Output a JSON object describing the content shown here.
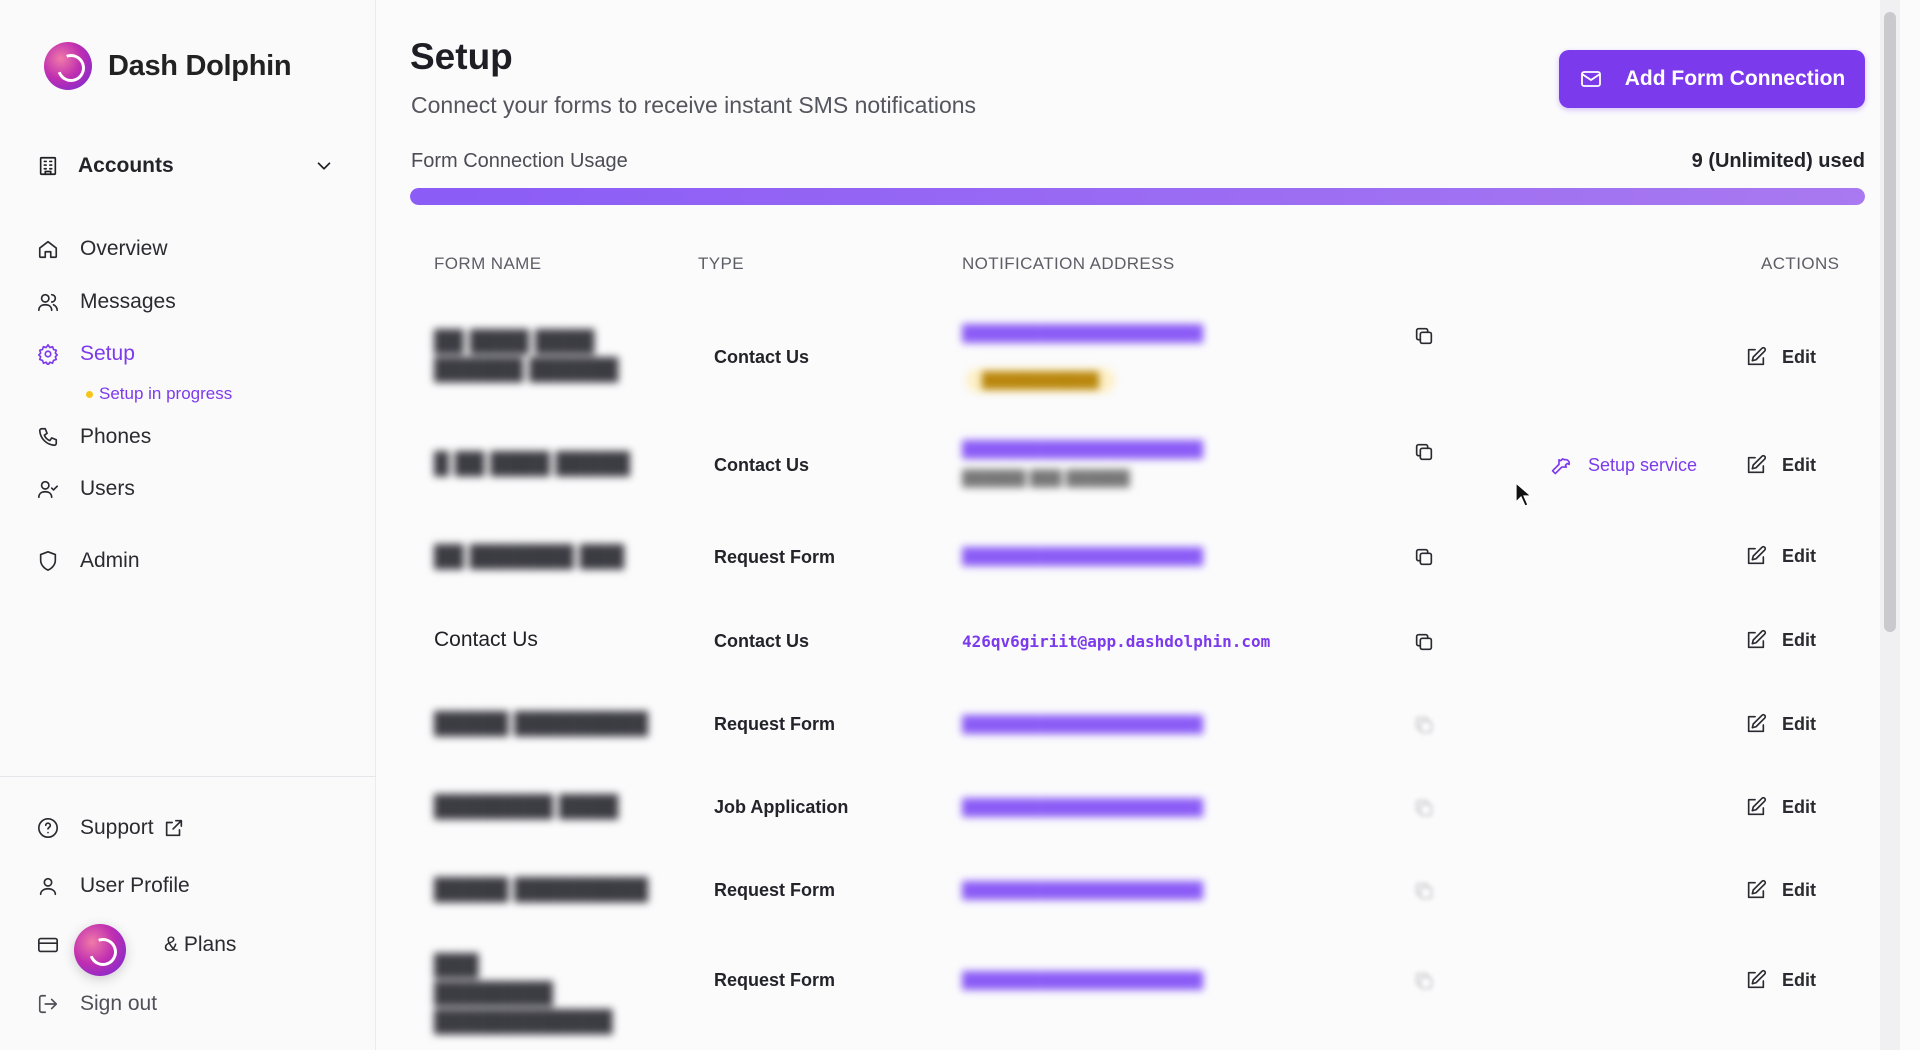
{
  "brand": {
    "name": "Dash Dolphin"
  },
  "sidebar": {
    "accounts_label": "Accounts",
    "items": [
      {
        "label": "Overview",
        "icon": "home-icon"
      },
      {
        "label": "Messages",
        "icon": "users-icon"
      },
      {
        "label": "Setup",
        "icon": "gear-icon"
      },
      {
        "label": "Phones",
        "icon": "phone-icon"
      },
      {
        "label": "Users",
        "icon": "user-check-icon"
      },
      {
        "label": "Admin",
        "icon": "shield-icon"
      }
    ],
    "setup_status": "Setup in progress",
    "bottom": [
      {
        "label": "Support",
        "icon": "help-circle-icon"
      },
      {
        "label": "User Profile",
        "icon": "user-icon"
      },
      {
        "label": "& Plans",
        "icon": "credit-card-icon"
      },
      {
        "label": "Sign out",
        "icon": "log-out-icon"
      }
    ]
  },
  "header": {
    "title": "Setup",
    "subtitle": "Connect your forms to receive instant SMS notifications",
    "add_button": "Add Form Connection"
  },
  "usage": {
    "label": "Form Connection Usage",
    "value": "9 (Unlimited) used",
    "fill_fraction": 1.0
  },
  "table": {
    "headers": [
      "FORM NAME",
      "TYPE",
      "NOTIFICATION ADDRESS",
      "ACTIONS"
    ],
    "setup_service_label": "Setup service",
    "edit_label": "Edit",
    "rows": [
      {
        "name": "",
        "type": "Contact Us",
        "address": "",
        "status": ""
      },
      {
        "name": "",
        "type": "Contact Us",
        "address": "",
        "status": ""
      },
      {
        "name": "",
        "type": "Request Form",
        "address": ""
      },
      {
        "name": "Contact Us",
        "type": "Contact Us",
        "address": "426qv6giriit@app.dashdolphin.com"
      },
      {
        "name": "",
        "type": "Request Form",
        "address": ""
      },
      {
        "name": "",
        "type": "Job Application",
        "address": ""
      },
      {
        "name": "",
        "type": "Request Form",
        "address": ""
      },
      {
        "name": "",
        "type": "Request Form",
        "address": ""
      }
    ]
  },
  "colors": {
    "accent": "#7c3aed",
    "status_dot": "#f5c518"
  }
}
